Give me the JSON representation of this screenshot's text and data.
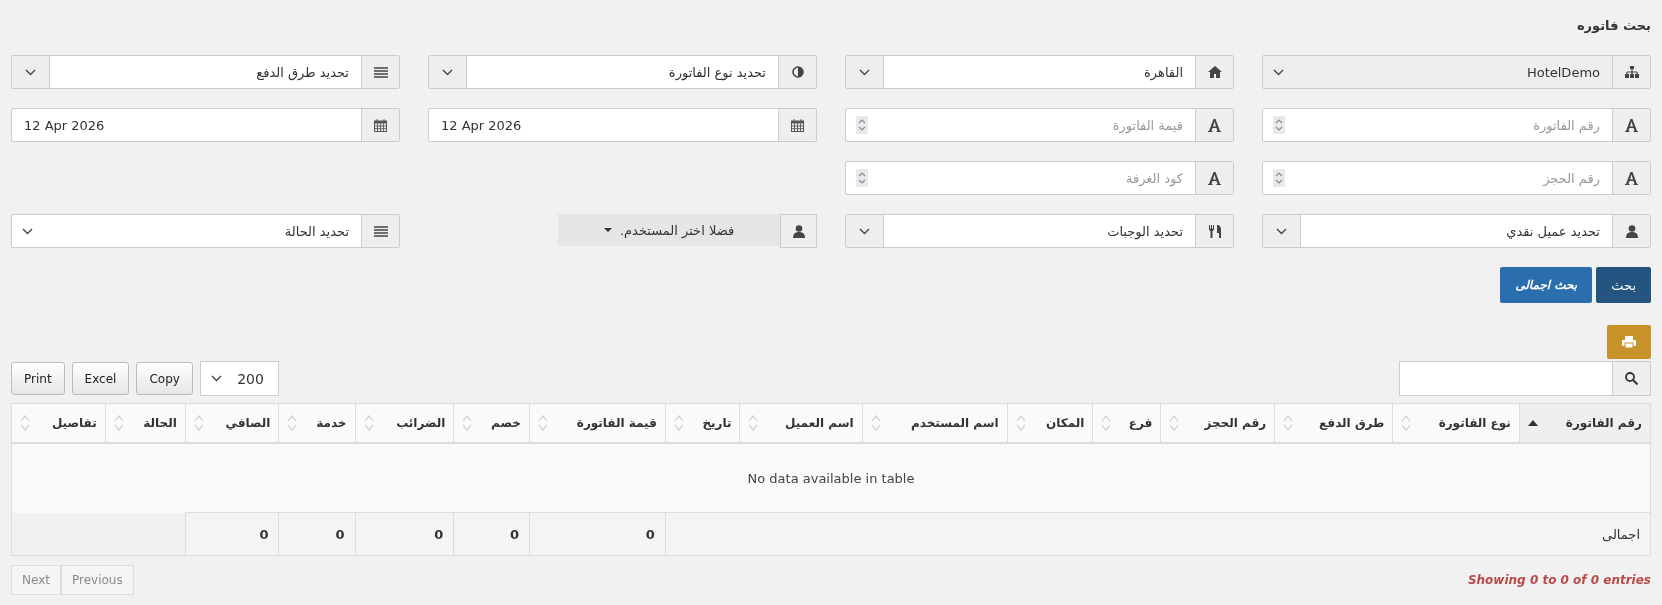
{
  "title": "بحث فاتوره",
  "filters": [
    {
      "kind": "select",
      "value": "HotelDemo",
      "disabled": true
    },
    {
      "kind": "combo",
      "value": "القاهرة",
      "disabled": false
    },
    {
      "kind": "combo",
      "value": "تحديد نوع الفاتورة",
      "disabled": false
    },
    {
      "kind": "combo",
      "value": "تحديد طرق الدفع",
      "disabled": false
    },
    {
      "kind": "number",
      "placeholder": "رقم الفاتورة"
    },
    {
      "kind": "number",
      "placeholder": "قيمة الفاتورة"
    },
    {
      "kind": "date",
      "value": "12 Apr 2026"
    },
    {
      "kind": "date",
      "value": "12 Apr 2026"
    },
    {
      "kind": "number",
      "placeholder": "رقم الحجز"
    },
    {
      "kind": "number",
      "placeholder": "كود الغرفة"
    },
    {
      "kind": "spacer"
    },
    {
      "kind": "spacer"
    },
    {
      "kind": "combo",
      "value": "تحديد عميل نقدي",
      "disabled": false
    },
    {
      "kind": "combo",
      "value": "تحديد الوجبات",
      "disabled": false
    },
    {
      "kind": "picker",
      "value": "فضلا اختر المستخدم."
    },
    {
      "kind": "select",
      "value": "تحديد الحالة",
      "disabled": false
    }
  ],
  "actions": [
    {
      "label": "بحث",
      "kind": "primary"
    },
    {
      "label": "بحث اجمالى",
      "kind": "info"
    }
  ],
  "table_tools": {
    "length": "200",
    "buttons": [
      "Copy",
      "Excel",
      "Print"
    ]
  },
  "table": {
    "columns": [
      {
        "label": "رقم الفاتورة",
        "sorted": true
      },
      {
        "label": "نوع الفاتورة",
        "sorted": false
      },
      {
        "label": "طرق الدفع",
        "sorted": false
      },
      {
        "label": "رقم الحجز",
        "sorted": false
      },
      {
        "label": "فرع",
        "sorted": false
      },
      {
        "label": "المكان",
        "sorted": false
      },
      {
        "label": "اسم المستخدم",
        "sorted": false
      },
      {
        "label": "اسم العميل",
        "sorted": false
      },
      {
        "label": "تاريخ",
        "sorted": false
      },
      {
        "label": "قيمة الفاتورة",
        "sorted": false,
        "total": "0"
      },
      {
        "label": "خصم",
        "sorted": false,
        "total": "0"
      },
      {
        "label": "الضرائب",
        "sorted": false,
        "total": "0"
      },
      {
        "label": "خدمة",
        "sorted": false,
        "total": "0"
      },
      {
        "label": "الصافي",
        "sorted": false,
        "total": "0"
      },
      {
        "label": "الحالة",
        "sorted": false
      },
      {
        "label": "تفاصيل",
        "sorted": false
      }
    ],
    "empty_message": "No data available in table",
    "footer_label": "اجمالى"
  },
  "info": "Showing 0 to 0 of 0 entries",
  "pagination": [
    {
      "label": "Previous",
      "disabled": true
    },
    {
      "label": "Next",
      "disabled": true
    }
  ]
}
